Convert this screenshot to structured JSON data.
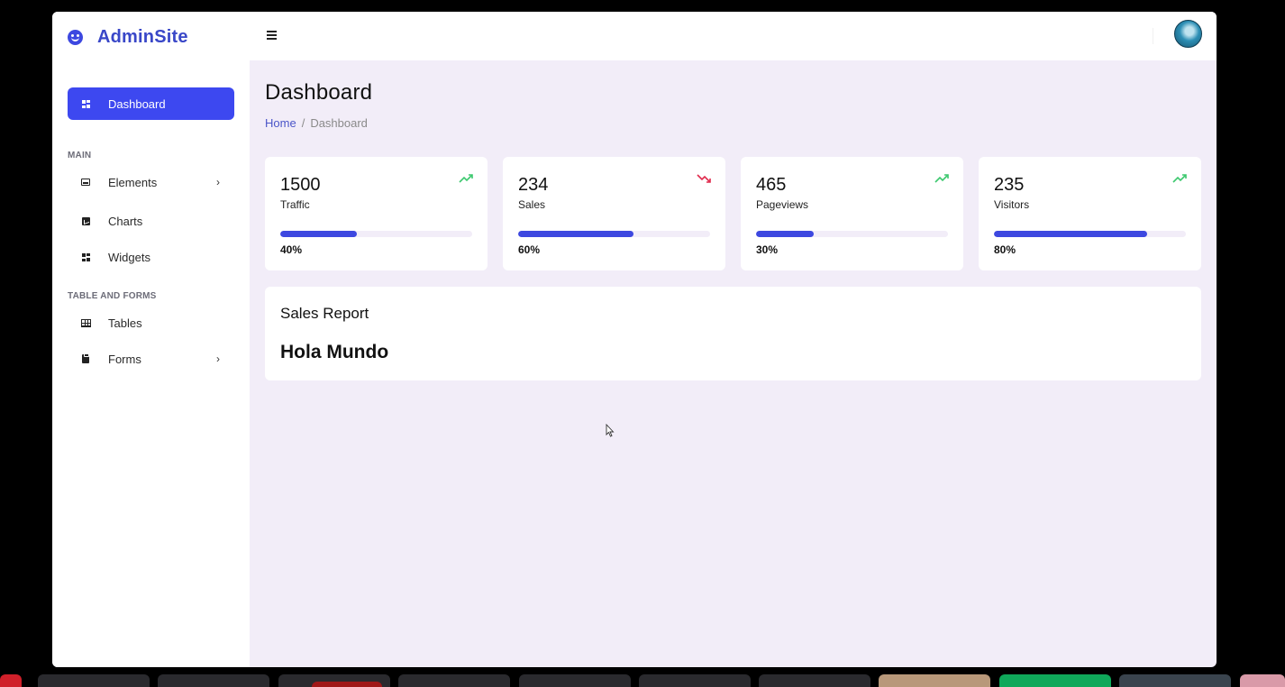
{
  "brand": {
    "name": "AdminSite",
    "accent": "#3d48e0"
  },
  "sidebar": {
    "active": {
      "label": "Dashboard"
    },
    "sections": [
      {
        "title": "MAIN",
        "items": [
          {
            "label": "Elements",
            "icon": "inbox-icon",
            "has_submenu": true
          },
          {
            "label": "Charts",
            "icon": "chart-icon",
            "has_submenu": false
          },
          {
            "label": "Widgets",
            "icon": "widgets-icon",
            "has_submenu": false
          }
        ]
      },
      {
        "title": "TABLE AND FORMS",
        "items": [
          {
            "label": "Tables",
            "icon": "table-icon",
            "has_submenu": false
          },
          {
            "label": "Forms",
            "icon": "clipboard-icon",
            "has_submenu": true
          }
        ]
      }
    ]
  },
  "header": {
    "title": "Dashboard",
    "breadcrumb": {
      "home": "Home",
      "separator": "/",
      "current": "Dashboard"
    }
  },
  "stats": [
    {
      "value": "1500",
      "label": "Traffic",
      "percent": "40%",
      "fill": 0.4,
      "trend": "up",
      "trend_color": "#3cc86e"
    },
    {
      "value": "234",
      "label": "Sales",
      "percent": "60%",
      "fill": 0.6,
      "trend": "down",
      "trend_color": "#e02a4c"
    },
    {
      "value": "465",
      "label": "Pageviews",
      "percent": "30%",
      "fill": 0.3,
      "trend": "up",
      "trend_color": "#3cc86e"
    },
    {
      "value": "235",
      "label": "Visitors",
      "percent": "80%",
      "fill": 0.8,
      "trend": "up",
      "trend_color": "#3cc86e"
    }
  ],
  "report": {
    "title": "Sales Report",
    "body": "Hola Mundo"
  }
}
